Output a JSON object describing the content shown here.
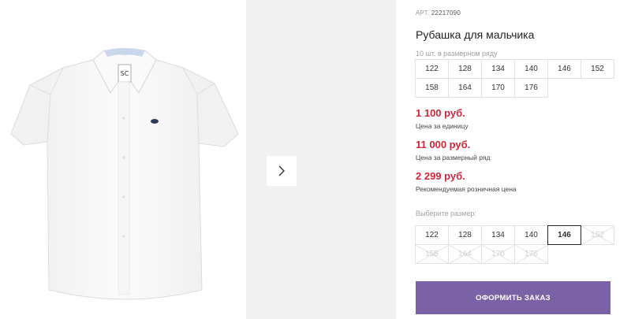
{
  "product": {
    "sku_label": "АРТ.",
    "sku_value": "22217090",
    "title": "Рубашка для мальчика",
    "series_note": "10 шт. в размерном ряду"
  },
  "series_sizes": [
    "122",
    "128",
    "134",
    "140",
    "146",
    "152",
    "158",
    "164",
    "170",
    "176"
  ],
  "prices": [
    {
      "value": "1 100 руб.",
      "label": "Цена за единицу"
    },
    {
      "value": "11 000 руб.",
      "label": "Цена за размерный ряд"
    },
    {
      "value": "2 299 руб.",
      "label": "Рекомендуемая розничная цена"
    }
  ],
  "choose": {
    "label": "Выберите размер:",
    "sizes": [
      {
        "size": "122",
        "state": "available"
      },
      {
        "size": "128",
        "state": "available"
      },
      {
        "size": "134",
        "state": "available"
      },
      {
        "size": "140",
        "state": "available"
      },
      {
        "size": "146",
        "state": "selected"
      },
      {
        "size": "152",
        "state": "disabled"
      },
      {
        "size": "158",
        "state": "disabled"
      },
      {
        "size": "164",
        "state": "disabled"
      },
      {
        "size": "170",
        "state": "disabled"
      },
      {
        "size": "176",
        "state": "disabled"
      }
    ]
  },
  "order_button_label": "ОФОРМИТЬ ЗАКАЗ",
  "colors": {
    "accent": "#7b62a6",
    "price": "#d0263a",
    "gallery_bg": "#f1f1f1"
  },
  "icons": {
    "next": "chevron-right-icon",
    "product_image": "white-shirt"
  }
}
